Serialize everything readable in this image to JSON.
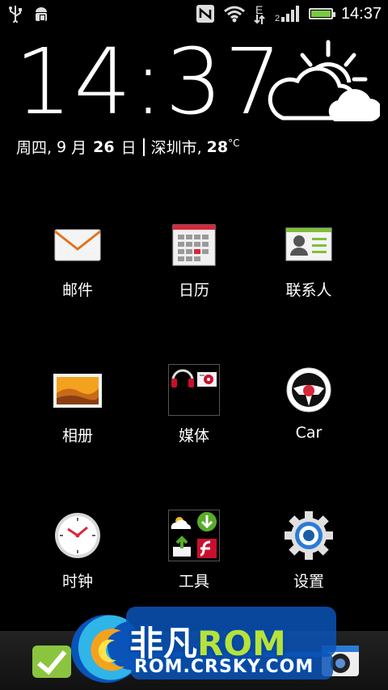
{
  "status_bar": {
    "time": "14:37",
    "icons": [
      "usb-icon",
      "android-debug-icon",
      "nfc-icon",
      "wifi-icon",
      "edge-signal-icon",
      "signal-icon",
      "battery-icon"
    ],
    "network_label": "E"
  },
  "clock_widget": {
    "time": "14:37",
    "weekday": "周四,",
    "month_num": "9",
    "month_word": "月",
    "day_num": "26",
    "day_word": "日",
    "city": "深圳市,",
    "temp": "28",
    "unit": "°C",
    "weather_icon": "partly-cloudy-icon"
  },
  "apps": [
    {
      "label": "邮件",
      "icon": "mail-icon"
    },
    {
      "label": "日历",
      "icon": "calendar-icon"
    },
    {
      "label": "联系人",
      "icon": "contacts-icon"
    },
    {
      "label": "相册",
      "icon": "gallery-icon"
    },
    {
      "label": "媒体",
      "icon": "media-folder-icon"
    },
    {
      "label": "Car",
      "icon": "car-steering-icon"
    },
    {
      "label": "时钟",
      "icon": "clock-icon"
    },
    {
      "label": "工具",
      "icon": "tools-folder-icon"
    },
    {
      "label": "设置",
      "icon": "settings-gear-icon"
    }
  ],
  "watermark": {
    "title_cn": "非凡",
    "title_rom": "ROM",
    "url": "ROM.CRSKY.COM"
  },
  "colors": {
    "background": "#000000",
    "battery_green": "#7ac943",
    "watermark_blue": "#0050b4",
    "watermark_green": "#b6e23a"
  }
}
